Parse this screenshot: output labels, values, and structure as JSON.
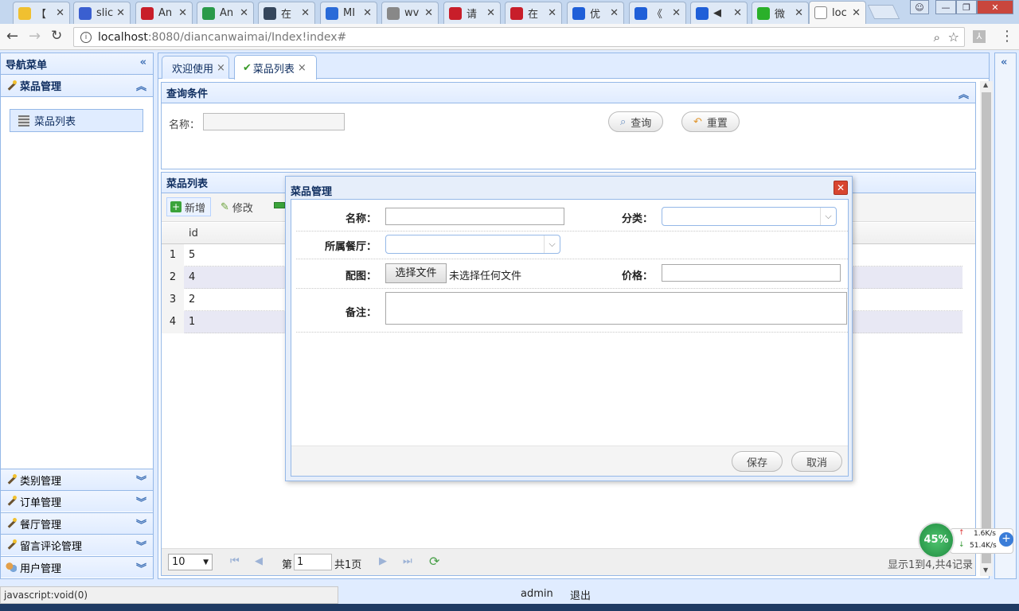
{
  "browser": {
    "tabs": [
      {
        "label": "【",
        "color": "#f0c030"
      },
      {
        "label": "slic",
        "color": "#3a5fd0"
      },
      {
        "label": "An",
        "color": "#c81e2a"
      },
      {
        "label": "An",
        "color": "#2a9a4a"
      },
      {
        "label": "在",
        "color": "#35465c"
      },
      {
        "label": "MI",
        "color": "#2a6bd8"
      },
      {
        "label": "wv",
        "color": "#888888"
      },
      {
        "label": "请",
        "color": "#c81e2a"
      },
      {
        "label": "在",
        "color": "#c81e2a"
      },
      {
        "label": "优",
        "color": "#1f5fd8"
      },
      {
        "label": "《",
        "color": "#1f5fd8"
      },
      {
        "label": "◀",
        "color": "#1f5fd8"
      },
      {
        "label": "微",
        "color": "#2ab02a"
      },
      {
        "label": "loc",
        "color": "#ffffff"
      }
    ],
    "url_host": "localhost",
    "url_rest": ":8080/diancanwaimai/Index!index#"
  },
  "sidebar": {
    "title": "导航菜单",
    "sections": [
      "菜品管理",
      "类别管理",
      "订单管理",
      "餐厅管理",
      "留言评论管理",
      "用户管理"
    ],
    "active_item": "菜品列表"
  },
  "content_tabs": [
    "欢迎使用",
    "菜品列表"
  ],
  "query": {
    "title": "查询条件",
    "name_label": "名称：",
    "search_label": "查询",
    "reset_label": "重置"
  },
  "grid": {
    "title": "菜品列表",
    "toolbar": [
      "新增",
      "修改"
    ],
    "column_header": "id",
    "rows": [
      {
        "n": "1",
        "id": "5"
      },
      {
        "n": "2",
        "id": "4"
      },
      {
        "n": "3",
        "id": "2"
      },
      {
        "n": "4",
        "id": "1"
      }
    ],
    "pager": {
      "page_size": "10",
      "page_prefix": "第",
      "page_value": "1",
      "page_total": "共1页",
      "summary": "显示1到4,共4记录"
    }
  },
  "dialog": {
    "title": "菜品管理",
    "name_label": "名称：",
    "category_label": "分类：",
    "restaurant_label": "所属餐厅：",
    "image_label": "配图：",
    "file_button": "选择文件",
    "file_status": "未选择任何文件",
    "price_label": "价格：",
    "remark_label": "备注：",
    "save_label": "保存",
    "cancel_label": "取消"
  },
  "footer": {
    "user": "admin",
    "logout": "退出"
  },
  "status_bar": "javascript:void(0)",
  "net_widget": {
    "percent": "45%",
    "up": "1.6K/s",
    "down": "51.4K/s"
  }
}
